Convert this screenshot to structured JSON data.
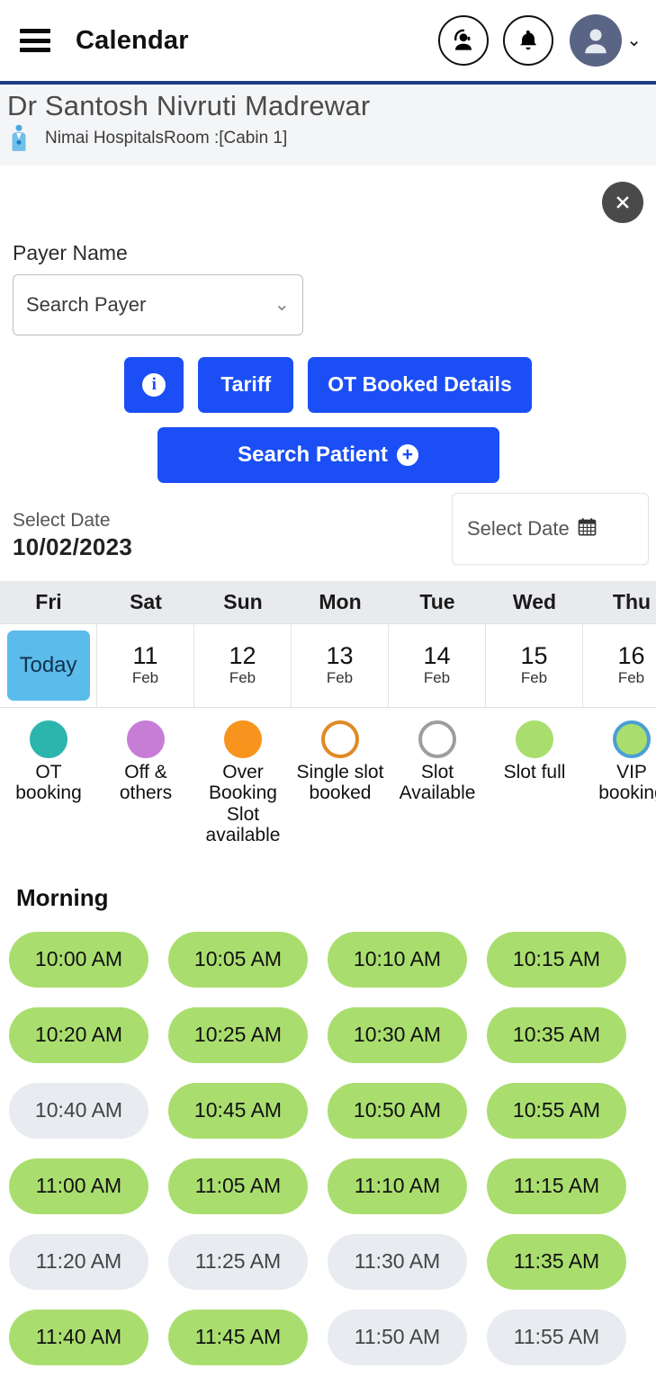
{
  "header": {
    "menu_icon": "hamburger-menu-icon",
    "title": "Calendar",
    "support_icon": "headset-support-icon",
    "notification_icon": "bell-icon",
    "avatar_icon": "user-avatar-icon",
    "chevron_icon": "chevron-down-icon"
  },
  "doctor": {
    "name": "Dr Santosh Nivruti Madrewar",
    "icon": "doctor-icon",
    "hospital": "Nimai Hospitals",
    "room": "Room :[Cabin 1]"
  },
  "close": {
    "icon": "close-x-icon"
  },
  "payer": {
    "label": "Payer Name",
    "value": "Search Payer",
    "chevron": "chevron-down-icon"
  },
  "actions": {
    "info_label": "i",
    "tariff_label": "Tariff",
    "ot_booked_label": "OT Booked Details",
    "search_patient_label": "Search Patient",
    "plus_label": "+"
  },
  "select_date": {
    "label": "Select Date",
    "value": "10/02/2023",
    "picker_label": "Select Date",
    "picker_icon": "calendar-icon"
  },
  "week": {
    "days": [
      {
        "weekday": "Fri",
        "num": "Today",
        "month": "",
        "is_today": true
      },
      {
        "weekday": "Sat",
        "num": "11",
        "month": "Feb",
        "is_today": false
      },
      {
        "weekday": "Sun",
        "num": "12",
        "month": "Feb",
        "is_today": false
      },
      {
        "weekday": "Mon",
        "num": "13",
        "month": "Feb",
        "is_today": false
      },
      {
        "weekday": "Tue",
        "num": "14",
        "month": "Feb",
        "is_today": false
      },
      {
        "weekday": "Wed",
        "num": "15",
        "month": "Feb",
        "is_today": false
      },
      {
        "weekday": "Thu",
        "num": "16",
        "month": "Feb",
        "is_today": false
      }
    ]
  },
  "legend": [
    {
      "label": "OT booking",
      "color": "#2bb5ad",
      "border": "#2bb5ad"
    },
    {
      "label": "Off & others",
      "color": "#c77dd6",
      "border": "#c77dd6"
    },
    {
      "label": "Over Booking Slot available",
      "color": "#f7941d",
      "border": "#f7941d"
    },
    {
      "label": "Single slot booked",
      "color": "#ffffff",
      "border": "#e08a22"
    },
    {
      "label": "Slot Available",
      "color": "#ffffff",
      "border": "#9e9e9e"
    },
    {
      "label": "Slot full",
      "color": "#a9de6e",
      "border": "#a9de6e"
    },
    {
      "label": "VIP booking",
      "color": "#a9de6e",
      "border": "#4a9fd4"
    }
  ],
  "session": {
    "title": "Morning"
  },
  "slots": [
    {
      "time": "10:00 AM",
      "state": "full"
    },
    {
      "time": "10:05 AM",
      "state": "full"
    },
    {
      "time": "10:10 AM",
      "state": "full"
    },
    {
      "time": "10:15 AM",
      "state": "full"
    },
    {
      "time": "10:20 AM",
      "state": "full"
    },
    {
      "time": "10:25 AM",
      "state": "full"
    },
    {
      "time": "10:30 AM",
      "state": "full"
    },
    {
      "time": "10:35 AM",
      "state": "full"
    },
    {
      "time": "10:40 AM",
      "state": "avail"
    },
    {
      "time": "10:45 AM",
      "state": "full"
    },
    {
      "time": "10:50 AM",
      "state": "full"
    },
    {
      "time": "10:55 AM",
      "state": "full"
    },
    {
      "time": "11:00 AM",
      "state": "full"
    },
    {
      "time": "11:05 AM",
      "state": "full"
    },
    {
      "time": "11:10 AM",
      "state": "full"
    },
    {
      "time": "11:15 AM",
      "state": "full"
    },
    {
      "time": "11:20 AM",
      "state": "avail"
    },
    {
      "time": "11:25 AM",
      "state": "avail"
    },
    {
      "time": "11:30 AM",
      "state": "avail"
    },
    {
      "time": "11:35 AM",
      "state": "full"
    },
    {
      "time": "11:40 AM",
      "state": "full"
    },
    {
      "time": "11:45 AM",
      "state": "full"
    },
    {
      "time": "11:50 AM",
      "state": "avail"
    },
    {
      "time": "11:55 AM",
      "state": "avail"
    }
  ],
  "colors": {
    "primary_blue": "#1b4ff5",
    "today_blue": "#5bbcec",
    "slot_full": "#a9de6e",
    "slot_available": "#e8ebf0",
    "rule_blue": "#1b3a86"
  }
}
